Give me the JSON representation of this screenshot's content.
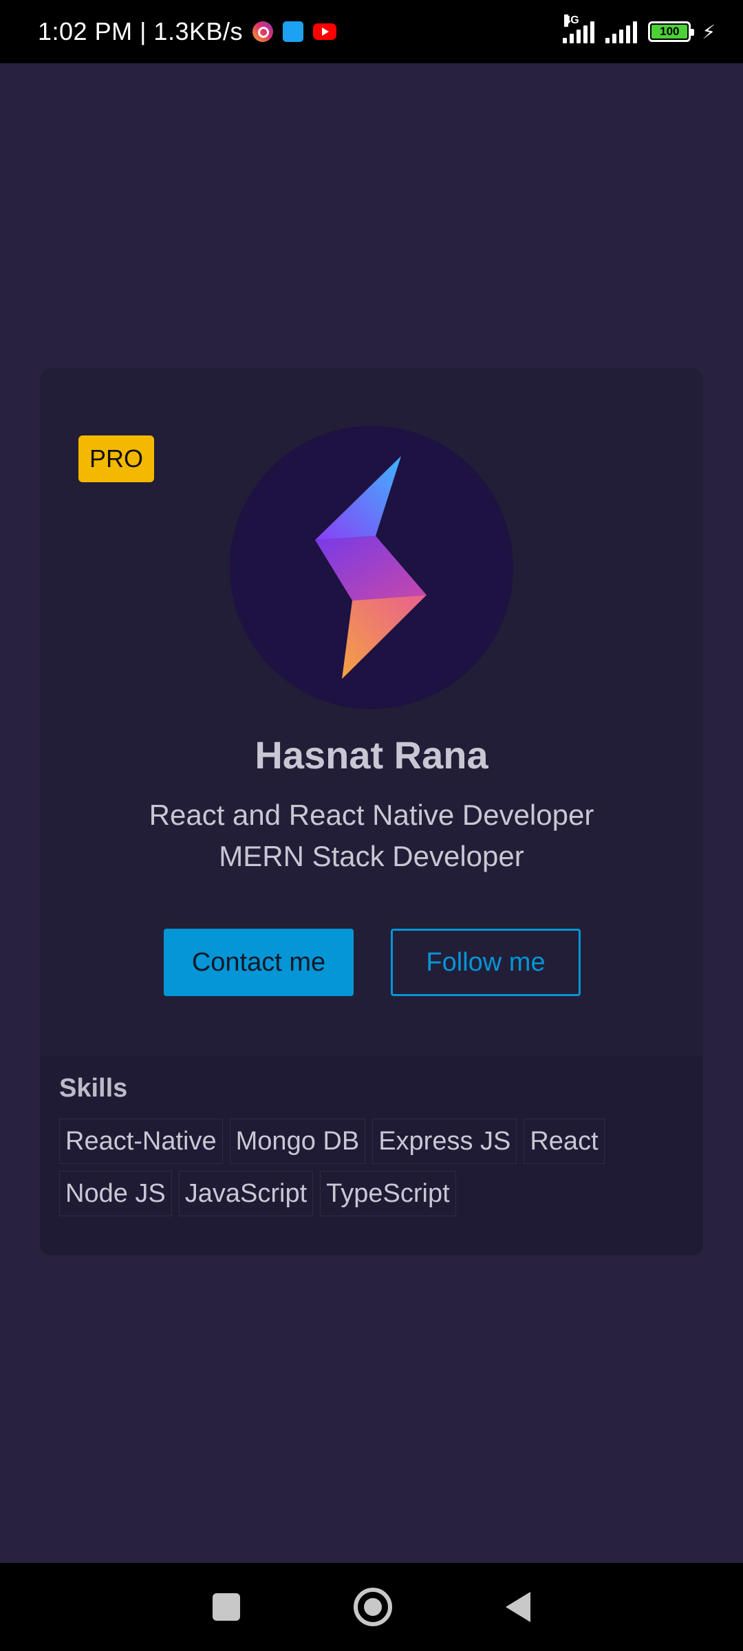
{
  "status_bar": {
    "time": "1:02 PM | 1.3KB/s",
    "network": "4G",
    "battery": "100",
    "apps": [
      "instagram-icon",
      "twitter-icon",
      "youtube-icon"
    ]
  },
  "profile": {
    "badge": "PRO",
    "name": "Hasnat Rana",
    "subtitle_line1": "React and React Native Developer",
    "subtitle_line2": "MERN Stack Developer",
    "contact_label": "Contact me",
    "follow_label": "Follow me"
  },
  "skills": {
    "title": "Skills",
    "items": [
      "React-Native",
      "Mongo DB",
      "Express JS",
      "React",
      "Node JS",
      "JavaScript",
      "TypeScript"
    ]
  },
  "colors": {
    "background": "#28223f",
    "card": "#221e37",
    "accent": "#0496d6",
    "badge": "#f5b800"
  }
}
